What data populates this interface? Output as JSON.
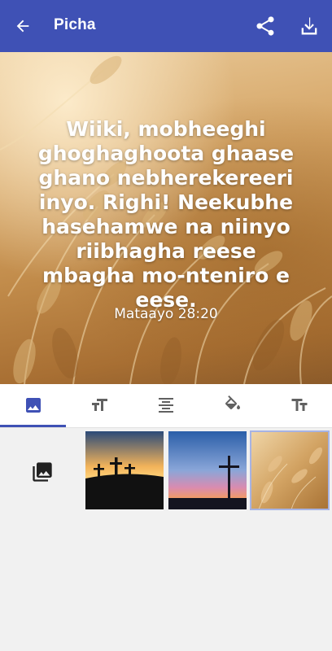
{
  "appbar": {
    "title": "Picha",
    "back_icon": "arrow-left-icon",
    "share_icon": "share-icon",
    "download_icon": "download-icon",
    "background_color": "#3f51b5"
  },
  "preview": {
    "verse_text": "Wiiki, mobheeghi ghoghaghoota ghaase ghano nebherekereeri inyo. Righi! Neekubhe hasehamwe na niinyo riibhagha reese mbagha mo-nteniro e eese.",
    "reference": "Mataayo 28:20",
    "background": "wheat-field"
  },
  "tabs": [
    {
      "icon": "image-icon",
      "active": true
    },
    {
      "icon": "font-size-icon",
      "active": false
    },
    {
      "icon": "align-center-icon",
      "active": false
    },
    {
      "icon": "paint-bucket-icon",
      "active": false
    },
    {
      "icon": "text-format-icon",
      "active": false
    }
  ],
  "backgrounds": {
    "gallery_icon": "photo-library-icon",
    "thumbnails": [
      {
        "name": "three-crosses-sunset",
        "selected": false
      },
      {
        "name": "cross-dusk",
        "selected": false
      },
      {
        "name": "wheat-field",
        "selected": true
      }
    ]
  },
  "accent_color": "#3f51b5"
}
